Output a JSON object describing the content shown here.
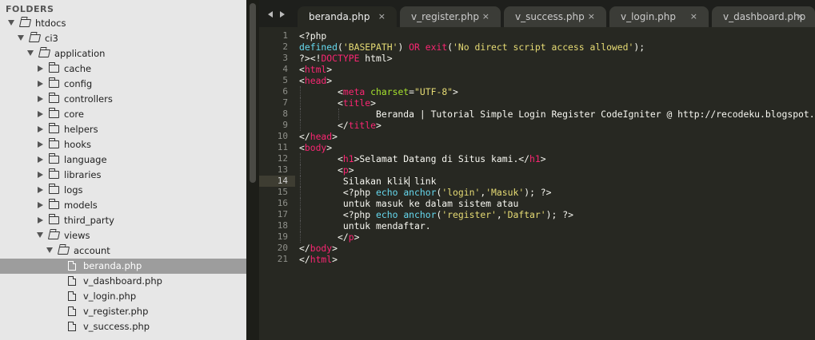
{
  "colors": {
    "tag": "#f92672",
    "attr": "#a6e22e",
    "string": "#e6db74",
    "func": "#66d9ef",
    "text": "#f8f8f2"
  },
  "sidebar": {
    "header": "FOLDERS",
    "items": [
      {
        "label": "htdocs",
        "type": "folder",
        "expanded": true,
        "depth": 0
      },
      {
        "label": "ci3",
        "type": "folder",
        "expanded": true,
        "depth": 1
      },
      {
        "label": "application",
        "type": "folder",
        "expanded": true,
        "depth": 2
      },
      {
        "label": "cache",
        "type": "folder",
        "expanded": false,
        "depth": 3
      },
      {
        "label": "config",
        "type": "folder",
        "expanded": false,
        "depth": 3
      },
      {
        "label": "controllers",
        "type": "folder",
        "expanded": false,
        "depth": 3
      },
      {
        "label": "core",
        "type": "folder",
        "expanded": false,
        "depth": 3
      },
      {
        "label": "helpers",
        "type": "folder",
        "expanded": false,
        "depth": 3
      },
      {
        "label": "hooks",
        "type": "folder",
        "expanded": false,
        "depth": 3
      },
      {
        "label": "language",
        "type": "folder",
        "expanded": false,
        "depth": 3
      },
      {
        "label": "libraries",
        "type": "folder",
        "expanded": false,
        "depth": 3
      },
      {
        "label": "logs",
        "type": "folder",
        "expanded": false,
        "depth": 3
      },
      {
        "label": "models",
        "type": "folder",
        "expanded": false,
        "depth": 3
      },
      {
        "label": "third_party",
        "type": "folder",
        "expanded": false,
        "depth": 3
      },
      {
        "label": "views",
        "type": "folder",
        "expanded": true,
        "depth": 3
      },
      {
        "label": "account",
        "type": "folder",
        "expanded": true,
        "depth": 4
      },
      {
        "label": "beranda.php",
        "type": "file",
        "selected": true,
        "depth": 5
      },
      {
        "label": "v_dashboard.php",
        "type": "file",
        "depth": 5
      },
      {
        "label": "v_login.php",
        "type": "file",
        "depth": 5
      },
      {
        "label": "v_register.php",
        "type": "file",
        "depth": 5
      },
      {
        "label": "v_success.php",
        "type": "file",
        "depth": 5
      }
    ]
  },
  "tabs": [
    {
      "label": "beranda.php",
      "active": true,
      "close": "×"
    },
    {
      "label": "v_register.php",
      "active": false,
      "close": "×"
    },
    {
      "label": "v_success.php",
      "active": false,
      "close": "×"
    },
    {
      "label": "v_login.php",
      "active": false,
      "close": "×"
    },
    {
      "label": "v_dashboard.php",
      "active": false,
      "close": "×"
    }
  ],
  "editor": {
    "current_line": 14,
    "line_numbers": [
      "1",
      "2",
      "3",
      "4",
      "5",
      "6",
      "7",
      "8",
      "9",
      "10",
      "11",
      "12",
      "13",
      "14",
      "15",
      "16",
      "17",
      "18",
      "19",
      "20",
      "21"
    ],
    "lines": [
      {
        "indent": 0,
        "tokens": [
          {
            "t": "<?php",
            "c": "text"
          }
        ]
      },
      {
        "indent": 0,
        "tokens": [
          {
            "t": "defined",
            "c": "func"
          },
          {
            "t": "(",
            "c": "text"
          },
          {
            "t": "'BASEPATH'",
            "c": "string"
          },
          {
            "t": ") ",
            "c": "text"
          },
          {
            "t": "OR",
            "c": "tag"
          },
          {
            "t": " ",
            "c": "text"
          },
          {
            "t": "exit",
            "c": "tag"
          },
          {
            "t": "(",
            "c": "text"
          },
          {
            "t": "'No direct script access allowed'",
            "c": "string"
          },
          {
            "t": ");",
            "c": "text"
          }
        ]
      },
      {
        "indent": 0,
        "tokens": [
          {
            "t": "?><!",
            "c": "text"
          },
          {
            "t": "DOCTYPE",
            "c": "tag"
          },
          {
            "t": " html>",
            "c": "text"
          }
        ]
      },
      {
        "indent": 0,
        "tokens": [
          {
            "t": "<",
            "c": "text"
          },
          {
            "t": "html",
            "c": "tag"
          },
          {
            "t": ">",
            "c": "text"
          }
        ]
      },
      {
        "indent": 0,
        "tokens": [
          {
            "t": "<",
            "c": "text"
          },
          {
            "t": "head",
            "c": "tag"
          },
          {
            "t": ">",
            "c": "text"
          }
        ]
      },
      {
        "indent": 1,
        "tokens": [
          {
            "t": "<",
            "c": "text"
          },
          {
            "t": "meta",
            "c": "tag"
          },
          {
            "t": " ",
            "c": "text"
          },
          {
            "t": "charset",
            "c": "attr"
          },
          {
            "t": "=",
            "c": "text"
          },
          {
            "t": "\"UTF-8\"",
            "c": "string"
          },
          {
            "t": ">",
            "c": "text"
          }
        ]
      },
      {
        "indent": 1,
        "tokens": [
          {
            "t": "<",
            "c": "text"
          },
          {
            "t": "title",
            "c": "tag"
          },
          {
            "t": ">",
            "c": "text"
          }
        ]
      },
      {
        "indent": 2,
        "tokens": [
          {
            "t": "Beranda | Tutorial Simple Login Register CodeIgniter @ http://recodeku.blogspot.com",
            "c": "text"
          }
        ]
      },
      {
        "indent": 1,
        "tokens": [
          {
            "t": "</",
            "c": "text"
          },
          {
            "t": "title",
            "c": "tag"
          },
          {
            "t": ">",
            "c": "text"
          }
        ]
      },
      {
        "indent": 0,
        "tokens": [
          {
            "t": "</",
            "c": "text"
          },
          {
            "t": "head",
            "c": "tag"
          },
          {
            "t": ">",
            "c": "text"
          }
        ]
      },
      {
        "indent": 0,
        "tokens": [
          {
            "t": "<",
            "c": "text"
          },
          {
            "t": "body",
            "c": "tag"
          },
          {
            "t": ">",
            "c": "text"
          }
        ]
      },
      {
        "indent": 1,
        "tokens": [
          {
            "t": "<",
            "c": "text"
          },
          {
            "t": "h1",
            "c": "tag"
          },
          {
            "t": ">Selamat Datang di Situs kami.</",
            "c": "text"
          },
          {
            "t": "h1",
            "c": "tag"
          },
          {
            "t": ">",
            "c": "text"
          }
        ]
      },
      {
        "indent": 1,
        "tokens": [
          {
            "t": "<",
            "c": "text"
          },
          {
            "t": "p",
            "c": "tag"
          },
          {
            "t": ">",
            "c": "text"
          }
        ]
      },
      {
        "indent": 1,
        "tokens": [
          {
            "t": " Silakan klik",
            "c": "text"
          },
          {
            "t": "|CARET|",
            "c": "caret"
          },
          {
            "t": " link",
            "c": "text"
          }
        ]
      },
      {
        "indent": 1,
        "tokens": [
          {
            "t": " <?php ",
            "c": "text"
          },
          {
            "t": "echo",
            "c": "func"
          },
          {
            "t": " ",
            "c": "text"
          },
          {
            "t": "anchor",
            "c": "func"
          },
          {
            "t": "(",
            "c": "text"
          },
          {
            "t": "'login'",
            "c": "string"
          },
          {
            "t": ",",
            "c": "text"
          },
          {
            "t": "'Masuk'",
            "c": "string"
          },
          {
            "t": "); ?>",
            "c": "text"
          }
        ]
      },
      {
        "indent": 1,
        "tokens": [
          {
            "t": " untuk masuk ke dalam sistem atau",
            "c": "text"
          }
        ]
      },
      {
        "indent": 1,
        "tokens": [
          {
            "t": " <?php ",
            "c": "text"
          },
          {
            "t": "echo",
            "c": "func"
          },
          {
            "t": " ",
            "c": "text"
          },
          {
            "t": "anchor",
            "c": "func"
          },
          {
            "t": "(",
            "c": "text"
          },
          {
            "t": "'register'",
            "c": "string"
          },
          {
            "t": ",",
            "c": "text"
          },
          {
            "t": "'Daftar'",
            "c": "string"
          },
          {
            "t": "); ?>",
            "c": "text"
          }
        ]
      },
      {
        "indent": 1,
        "tokens": [
          {
            "t": " untuk mendaftar.",
            "c": "text"
          }
        ]
      },
      {
        "indent": 1,
        "tokens": [
          {
            "t": "</",
            "c": "text"
          },
          {
            "t": "p",
            "c": "tag"
          },
          {
            "t": ">",
            "c": "text"
          }
        ]
      },
      {
        "indent": 0,
        "tokens": [
          {
            "t": "</",
            "c": "text"
          },
          {
            "t": "body",
            "c": "tag"
          },
          {
            "t": ">",
            "c": "text"
          }
        ]
      },
      {
        "indent": 0,
        "tokens": [
          {
            "t": "</",
            "c": "text"
          },
          {
            "t": "html",
            "c": "tag"
          },
          {
            "t": ">",
            "c": "text"
          }
        ]
      }
    ]
  }
}
